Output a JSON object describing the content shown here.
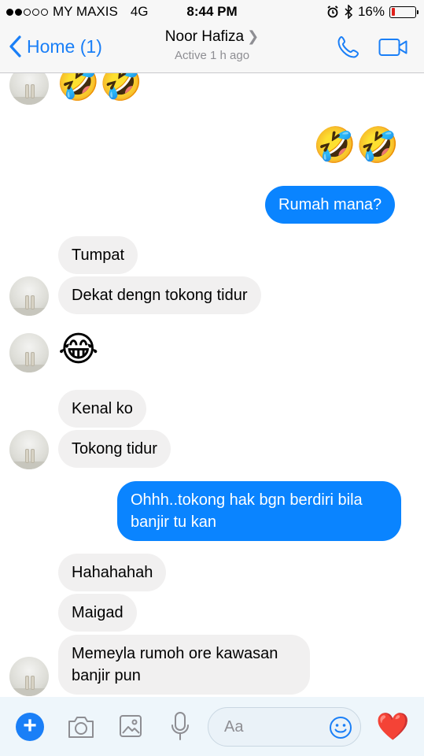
{
  "status_bar": {
    "carrier": "MY MAXIS",
    "network": "4G",
    "time": "8:44 PM",
    "battery": "16%",
    "battery_level": 0.16
  },
  "header": {
    "back_label": "Home (1)",
    "contact_name": "Noor Hafiza",
    "active_status": "Active 1 h ago",
    "icons": [
      "phone-icon",
      "video-call-icon"
    ]
  },
  "messages": {
    "m0": "🤣🤣",
    "m1": "🤣🤣",
    "m2": "Rumah mana?",
    "m3": "Tumpat",
    "m4": "Dekat dengn tokong tidur",
    "m5": "😂",
    "m6": "Kenal ko",
    "m7": "Tokong tidur",
    "m8a": "Ohhh..tokong hak bgn berdiri bila",
    "m8b": "banjir tu kan",
    "m9": "Hahahahah",
    "m10": "Maigad",
    "m11a": "Memeyla rumoh ore kawasan",
    "m11b": "banjir pun"
  },
  "composer": {
    "placeholder": "Aa",
    "like_emoji": "❤️",
    "icons": [
      "plus-icon",
      "camera-icon",
      "gallery-icon",
      "microphone-icon",
      "emoji-icon"
    ]
  },
  "colors": {
    "accent": "#1a7ff7",
    "outgoing_bubble": "#0a84ff",
    "incoming_bubble": "#f1f0f0",
    "battery_low": "#e0201a"
  }
}
